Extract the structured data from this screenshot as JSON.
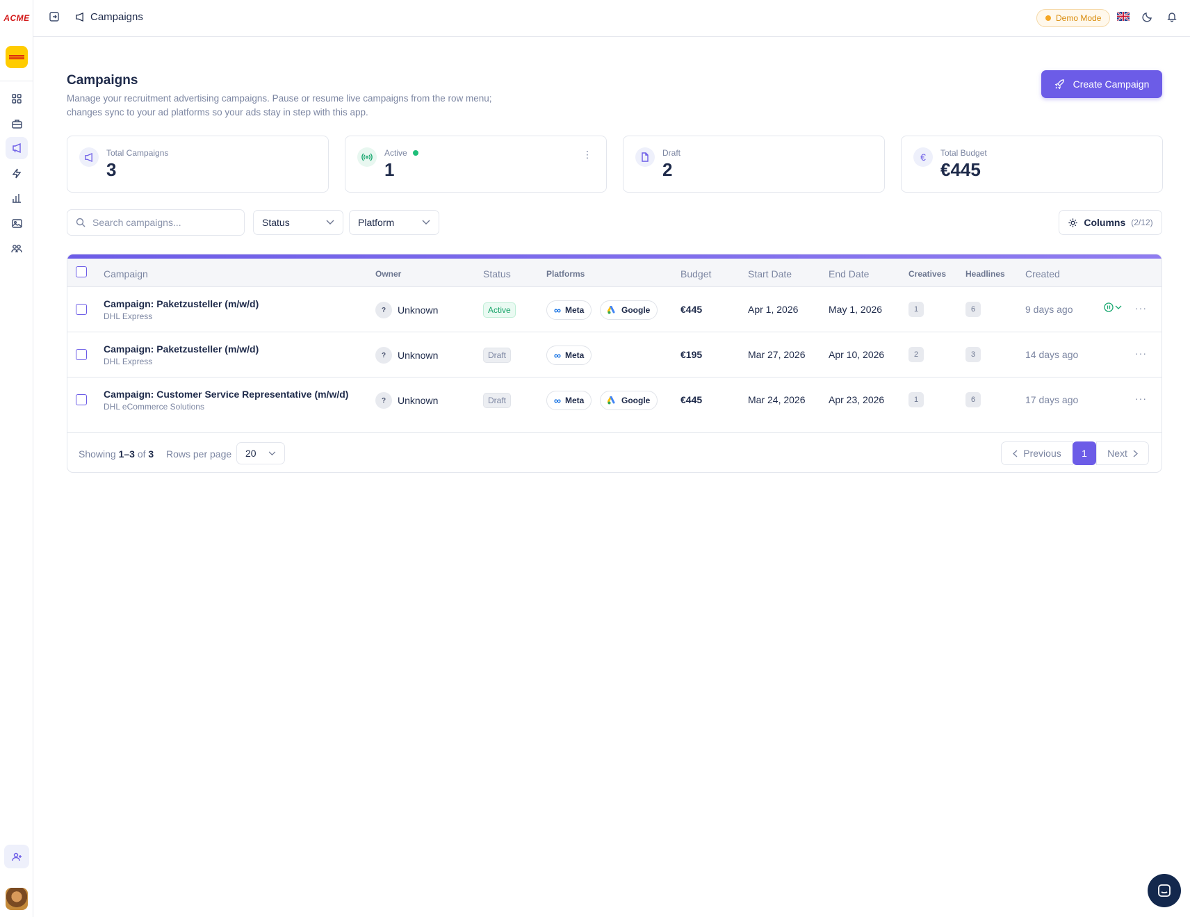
{
  "app": {
    "logo_text": "ACME",
    "brand_color": "#6c5ce7"
  },
  "header": {
    "breadcrumb": "Campaigns",
    "demo_badge": "Demo Mode"
  },
  "sidebar": {
    "items": [
      "dashboard",
      "jobs",
      "campaigns",
      "automations",
      "analytics",
      "media",
      "team"
    ]
  },
  "page": {
    "title": "Campaigns",
    "subtitle": "Manage your recruitment advertising campaigns. Pause or resume live campaigns from the row menu; changes sync to your ad platforms so your ads stay in step with this app.",
    "create_label": "Create Campaign"
  },
  "stats": {
    "total": {
      "label": "Total Campaigns",
      "value": "3"
    },
    "active": {
      "label": "Active",
      "value": "1"
    },
    "draft": {
      "label": "Draft",
      "value": "2"
    },
    "budget": {
      "label": "Total Budget",
      "value": "€445"
    }
  },
  "filters": {
    "search_placeholder": "Search campaigns...",
    "status_label": "Status",
    "platform_label": "Platform",
    "columns_label": "Columns",
    "columns_count": "(2/12)"
  },
  "table": {
    "headers": [
      "Campaign",
      "Owner",
      "Status",
      "Platforms",
      "Budget",
      "Start Date",
      "End Date",
      "Creatives",
      "Headlines",
      "Created"
    ],
    "rows": [
      {
        "name": "Campaign: Paketzusteller (m/w/d)",
        "org": "DHL Express",
        "owner_initial": "?",
        "owner": "Unknown",
        "status": "Active",
        "platforms": [
          "Meta",
          "Google"
        ],
        "budget": "€445",
        "start": "Apr 1, 2026",
        "end": "May 1, 2026",
        "creatives": "1",
        "headlines": "6",
        "created": "9 days ago"
      },
      {
        "name": "Campaign: Paketzusteller (m/w/d)",
        "org": "DHL Express",
        "owner_initial": "?",
        "owner": "Unknown",
        "status": "Draft",
        "platforms": [
          "Meta"
        ],
        "budget": "€195",
        "start": "Mar 27, 2026",
        "end": "Apr 10, 2026",
        "creatives": "2",
        "headlines": "3",
        "created": "14 days ago"
      },
      {
        "name": "Campaign: Customer Service Representative (m/w/d)",
        "org": "DHL eCommerce Solutions",
        "owner_initial": "?",
        "owner": "Unknown",
        "status": "Draft",
        "platforms": [
          "Meta",
          "Google"
        ],
        "budget": "€445",
        "start": "Mar 24, 2026",
        "end": "Apr 23, 2026",
        "creatives": "1",
        "headlines": "6",
        "created": "17 days ago"
      }
    ]
  },
  "pagination": {
    "showing_prefix": "Showing",
    "range": "1–3",
    "of": "of",
    "total": "3",
    "rows_per_page_label": "Rows per page",
    "rows_per_page": "20",
    "prev_label": "Previous",
    "page": "1",
    "next_label": "Next"
  }
}
